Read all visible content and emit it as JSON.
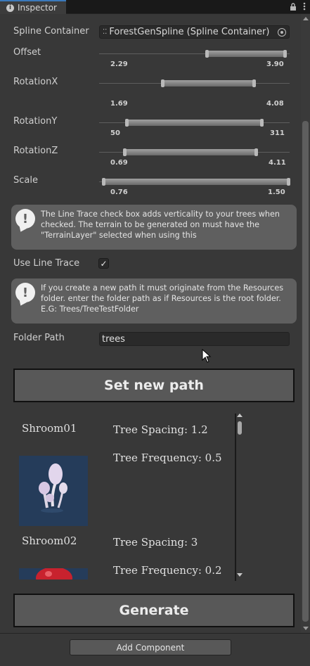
{
  "tab": {
    "title": "Inspector",
    "info_icon": "info-icon",
    "lock_icon": "lock-icon",
    "menu_icon": "kebab-menu-icon"
  },
  "fields": {
    "spline_container": {
      "label": "Spline Container",
      "value": "ForestGenSpline (Spline Container)"
    },
    "offset": {
      "label": "Offset",
      "min": "2.29",
      "max": "3.90",
      "min_fraction": 0.56,
      "max_fraction": 0.98
    },
    "rotation_x": {
      "label": "RotationX",
      "min": "1.69",
      "max": "4.08",
      "min_fraction": 0.33,
      "max_fraction": 0.82
    },
    "rotation_y": {
      "label": "RotationY",
      "min": "50",
      "max": "311",
      "min_fraction": 0.14,
      "max_fraction": 0.86
    },
    "rotation_z": {
      "label": "RotationZ",
      "min": "0.69",
      "max": "4.11",
      "min_fraction": 0.13,
      "max_fraction": 0.83
    },
    "scale": {
      "label": "Scale",
      "min": "0.76",
      "max": "1.50",
      "min_fraction": 0.02,
      "max_fraction": 1.0
    },
    "use_line_trace": {
      "label": "Use Line Trace",
      "checked": true,
      "check_glyph": "✓"
    },
    "folder_path": {
      "label": "Folder Path",
      "value": "trees"
    }
  },
  "help": {
    "line_trace": "The Line Trace check box adds verticality to your trees when checked. The terrain to be generated on must have the \"TerrainLayer\" selected when using this",
    "folder": "If you create a new path it must originate from the Resources folder. enter the folder path as if Resources is the root folder. E.G: Trees/TreeTestFolder"
  },
  "buttons": {
    "set_new_path": "Set new path",
    "generate": "Generate",
    "add_component": "Add Component"
  },
  "trees": [
    {
      "name": "Shroom01",
      "spacing": "Tree Spacing: 1.2",
      "frequency": "Tree Frequency: 0.5"
    },
    {
      "name": "Shroom02",
      "spacing": "Tree Spacing: 3",
      "frequency": "Tree Frequency: 0.2"
    }
  ],
  "colors": {
    "background": "#383838",
    "help_box": "#5f5f5f",
    "button": "#585858",
    "thumbnail_bg": "#253c5a",
    "tab_accent": "#3a79bb"
  }
}
